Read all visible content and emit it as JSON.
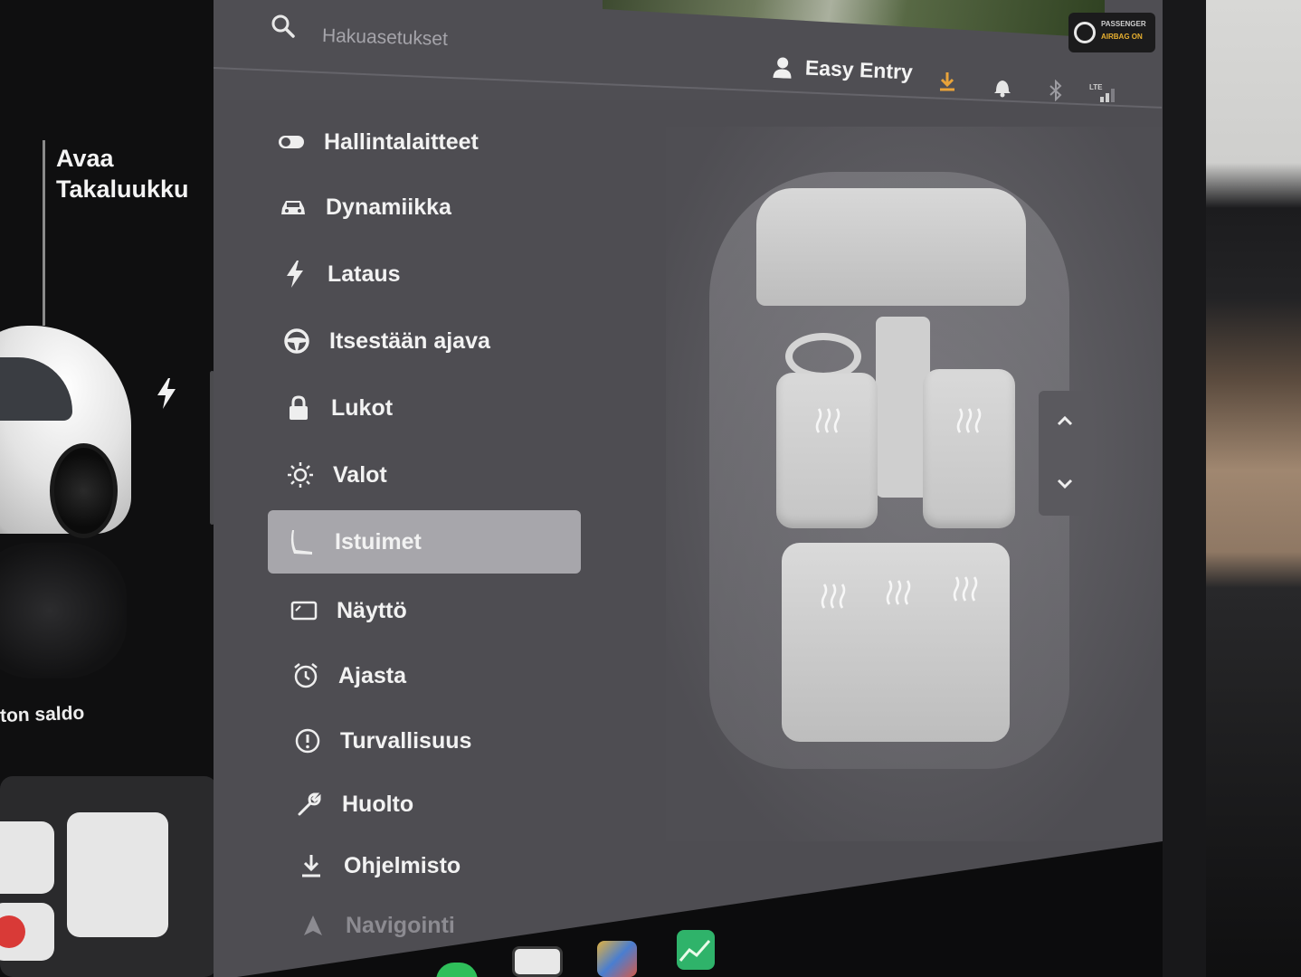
{
  "left_panel": {
    "tailgate_label_line1": "Avaa",
    "tailgate_label_line2": "Takaluukku",
    "balance_label": "ton saldo"
  },
  "topbar": {
    "search_placeholder": "Hakuasetukset",
    "profile_name": "Easy Entry",
    "airbag_line1": "PASSENGER",
    "airbag_line2": "AIRBAG ON",
    "status_icons": [
      "download-icon",
      "bell-icon",
      "bluetooth-icon",
      "lte-signal-icon"
    ],
    "download_color": "#e8a33a"
  },
  "menu": {
    "items": [
      {
        "label": "Hallintalaitteet",
        "icon": "toggle-icon"
      },
      {
        "label": "Dynamiikka",
        "icon": "car-icon"
      },
      {
        "label": "Lataus",
        "icon": "bolt-icon"
      },
      {
        "label": "Itsestään ajava",
        "icon": "steering-wheel-icon"
      },
      {
        "label": "Lukot",
        "icon": "lock-icon"
      },
      {
        "label": "Valot",
        "icon": "sun-icon"
      },
      {
        "label": "Istuimet",
        "icon": "seat-icon",
        "active": true
      },
      {
        "label": "Näyttö",
        "icon": "display-icon"
      },
      {
        "label": "Ajasta",
        "icon": "alarm-clock-icon"
      },
      {
        "label": "Turvallisuus",
        "icon": "alert-circle-icon"
      },
      {
        "label": "Huolto",
        "icon": "wrench-icon"
      },
      {
        "label": "Ohjelmisto",
        "icon": "download-icon"
      },
      {
        "label": "Navigointi",
        "icon": "navigation-icon"
      }
    ],
    "active_color": "#a7a6ab"
  },
  "seats": {
    "heaters": [
      "driver",
      "passenger",
      "rear-left",
      "rear-center",
      "rear-right"
    ]
  },
  "dock": {
    "volume": "muted"
  }
}
